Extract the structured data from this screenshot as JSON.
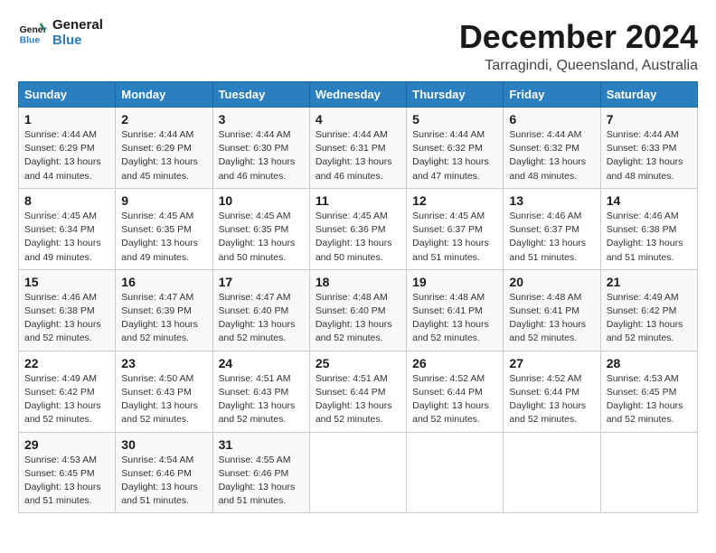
{
  "header": {
    "logo_line1": "General",
    "logo_line2": "Blue",
    "title": "December 2024",
    "subtitle": "Tarragindi, Queensland, Australia"
  },
  "weekdays": [
    "Sunday",
    "Monday",
    "Tuesday",
    "Wednesday",
    "Thursday",
    "Friday",
    "Saturday"
  ],
  "weeks": [
    [
      {
        "day": "1",
        "info": "Sunrise: 4:44 AM\nSunset: 6:29 PM\nDaylight: 13 hours\nand 44 minutes."
      },
      {
        "day": "2",
        "info": "Sunrise: 4:44 AM\nSunset: 6:29 PM\nDaylight: 13 hours\nand 45 minutes."
      },
      {
        "day": "3",
        "info": "Sunrise: 4:44 AM\nSunset: 6:30 PM\nDaylight: 13 hours\nand 46 minutes."
      },
      {
        "day": "4",
        "info": "Sunrise: 4:44 AM\nSunset: 6:31 PM\nDaylight: 13 hours\nand 46 minutes."
      },
      {
        "day": "5",
        "info": "Sunrise: 4:44 AM\nSunset: 6:32 PM\nDaylight: 13 hours\nand 47 minutes."
      },
      {
        "day": "6",
        "info": "Sunrise: 4:44 AM\nSunset: 6:32 PM\nDaylight: 13 hours\nand 48 minutes."
      },
      {
        "day": "7",
        "info": "Sunrise: 4:44 AM\nSunset: 6:33 PM\nDaylight: 13 hours\nand 48 minutes."
      }
    ],
    [
      {
        "day": "8",
        "info": "Sunrise: 4:45 AM\nSunset: 6:34 PM\nDaylight: 13 hours\nand 49 minutes."
      },
      {
        "day": "9",
        "info": "Sunrise: 4:45 AM\nSunset: 6:35 PM\nDaylight: 13 hours\nand 49 minutes."
      },
      {
        "day": "10",
        "info": "Sunrise: 4:45 AM\nSunset: 6:35 PM\nDaylight: 13 hours\nand 50 minutes."
      },
      {
        "day": "11",
        "info": "Sunrise: 4:45 AM\nSunset: 6:36 PM\nDaylight: 13 hours\nand 50 minutes."
      },
      {
        "day": "12",
        "info": "Sunrise: 4:45 AM\nSunset: 6:37 PM\nDaylight: 13 hours\nand 51 minutes."
      },
      {
        "day": "13",
        "info": "Sunrise: 4:46 AM\nSunset: 6:37 PM\nDaylight: 13 hours\nand 51 minutes."
      },
      {
        "day": "14",
        "info": "Sunrise: 4:46 AM\nSunset: 6:38 PM\nDaylight: 13 hours\nand 51 minutes."
      }
    ],
    [
      {
        "day": "15",
        "info": "Sunrise: 4:46 AM\nSunset: 6:38 PM\nDaylight: 13 hours\nand 52 minutes."
      },
      {
        "day": "16",
        "info": "Sunrise: 4:47 AM\nSunset: 6:39 PM\nDaylight: 13 hours\nand 52 minutes."
      },
      {
        "day": "17",
        "info": "Sunrise: 4:47 AM\nSunset: 6:40 PM\nDaylight: 13 hours\nand 52 minutes."
      },
      {
        "day": "18",
        "info": "Sunrise: 4:48 AM\nSunset: 6:40 PM\nDaylight: 13 hours\nand 52 minutes."
      },
      {
        "day": "19",
        "info": "Sunrise: 4:48 AM\nSunset: 6:41 PM\nDaylight: 13 hours\nand 52 minutes."
      },
      {
        "day": "20",
        "info": "Sunrise: 4:48 AM\nSunset: 6:41 PM\nDaylight: 13 hours\nand 52 minutes."
      },
      {
        "day": "21",
        "info": "Sunrise: 4:49 AM\nSunset: 6:42 PM\nDaylight: 13 hours\nand 52 minutes."
      }
    ],
    [
      {
        "day": "22",
        "info": "Sunrise: 4:49 AM\nSunset: 6:42 PM\nDaylight: 13 hours\nand 52 minutes."
      },
      {
        "day": "23",
        "info": "Sunrise: 4:50 AM\nSunset: 6:43 PM\nDaylight: 13 hours\nand 52 minutes."
      },
      {
        "day": "24",
        "info": "Sunrise: 4:51 AM\nSunset: 6:43 PM\nDaylight: 13 hours\nand 52 minutes."
      },
      {
        "day": "25",
        "info": "Sunrise: 4:51 AM\nSunset: 6:44 PM\nDaylight: 13 hours\nand 52 minutes."
      },
      {
        "day": "26",
        "info": "Sunrise: 4:52 AM\nSunset: 6:44 PM\nDaylight: 13 hours\nand 52 minutes."
      },
      {
        "day": "27",
        "info": "Sunrise: 4:52 AM\nSunset: 6:44 PM\nDaylight: 13 hours\nand 52 minutes."
      },
      {
        "day": "28",
        "info": "Sunrise: 4:53 AM\nSunset: 6:45 PM\nDaylight: 13 hours\nand 52 minutes."
      }
    ],
    [
      {
        "day": "29",
        "info": "Sunrise: 4:53 AM\nSunset: 6:45 PM\nDaylight: 13 hours\nand 51 minutes."
      },
      {
        "day": "30",
        "info": "Sunrise: 4:54 AM\nSunset: 6:46 PM\nDaylight: 13 hours\nand 51 minutes."
      },
      {
        "day": "31",
        "info": "Sunrise: 4:55 AM\nSunset: 6:46 PM\nDaylight: 13 hours\nand 51 minutes."
      },
      null,
      null,
      null,
      null
    ]
  ]
}
